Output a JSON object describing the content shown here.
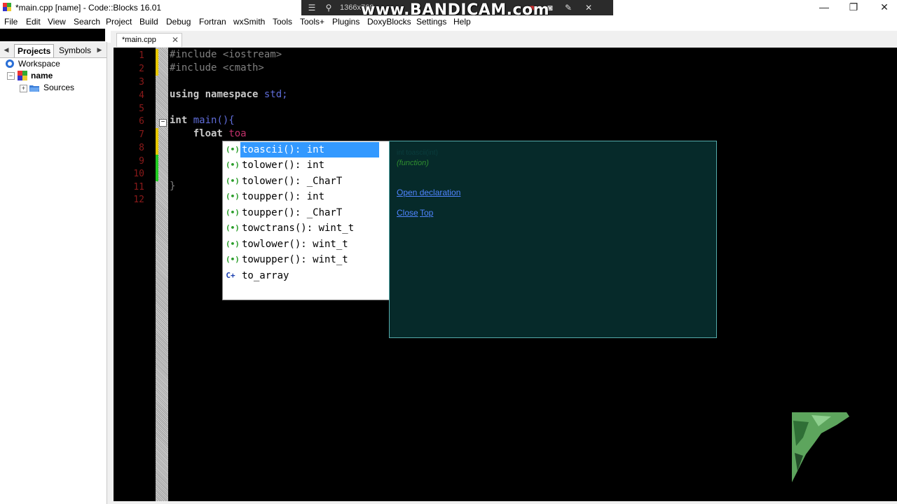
{
  "window": {
    "title": "*main.cpp [name] - Code::Blocks 16.01",
    "minimize": "—",
    "restore": "❐",
    "close": "✕"
  },
  "recorder": {
    "resolution": "1366x768",
    "watermark": "www.BANDICAM.com"
  },
  "menu": {
    "items": [
      "File",
      "Edit",
      "View",
      "Search",
      "Project",
      "Build",
      "Debug",
      "Fortran",
      "wxSmith",
      "Tools",
      "Tools+",
      "Plugins",
      "DoxyBlocks",
      "Settings",
      "Help"
    ]
  },
  "left_panel": {
    "tabs": [
      "Projects",
      "Symbols"
    ],
    "active_tab": "Projects",
    "tree": {
      "workspace": "Workspace",
      "project": "name",
      "folder": "Sources"
    }
  },
  "editor": {
    "tab_label": "*main.cpp",
    "tab_close": "✕",
    "line_numbers": [
      "1",
      "2",
      "3",
      "4",
      "5",
      "6",
      "7",
      "8",
      "9",
      "10",
      "11",
      "12"
    ],
    "lines": {
      "l1": "#include <iostream>",
      "l2": "#include <cmath>",
      "l4_kw1": "using",
      "l4_kw2": "namespace",
      "l4_id": "std;",
      "l6_kw": "int",
      "l6_fn": "main(){",
      "l7_kw": "float",
      "l7_id": "toa",
      "l11": "}"
    },
    "fold_glyph": "−"
  },
  "autocomplete": {
    "items": [
      {
        "text": "toascii(): int",
        "icon": "(•)",
        "selected": true
      },
      {
        "text": "tolower(): int",
        "icon": "(•)"
      },
      {
        "text": "tolower(): _CharT",
        "icon": "(•)"
      },
      {
        "text": "toupper(): int",
        "icon": "(•)"
      },
      {
        "text": "toupper(): _CharT",
        "icon": "(•)"
      },
      {
        "text": "towctrans(): wint_t",
        "icon": "(•)"
      },
      {
        "text": "towlower(): wint_t",
        "icon": "(•)"
      },
      {
        "text": "towupper(): wint_t",
        "icon": "(•)"
      },
      {
        "text": "to_array",
        "icon": "C+"
      }
    ]
  },
  "doc_popup": {
    "signature": "int toascii(int)",
    "kind": "(function)",
    "open_declaration": "Open declaration",
    "close": "Close",
    "top": "Top"
  },
  "colors": {
    "editor_bg": "#000000",
    "selection": "#3399ff",
    "doc_bg": "#062a2a",
    "change_yellow": "#e8c800",
    "change_green": "#22cc22"
  }
}
